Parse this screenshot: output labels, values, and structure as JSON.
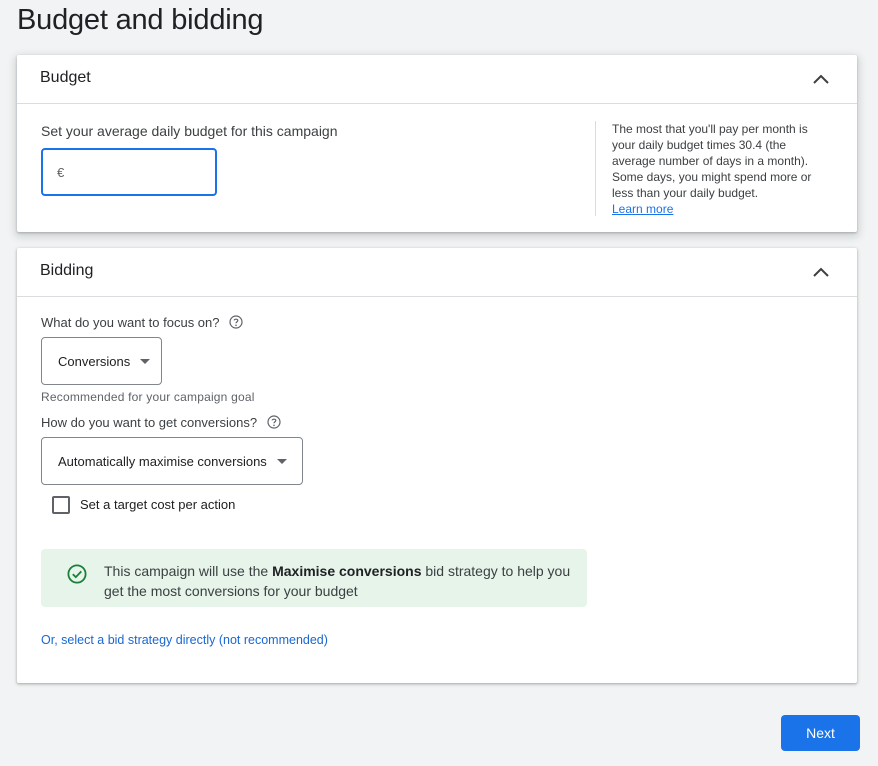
{
  "page": {
    "title": "Budget and bidding"
  },
  "budget": {
    "title": "Budget",
    "prompt": "Set your average daily budget for this campaign",
    "currency_symbol": "€",
    "value": "",
    "side_note": "The most that you'll pay per month is your daily budget times 30.4 (the average number of days in a month). Some days, you might spend more or less than your daily budget.",
    "learn_more": "Learn more"
  },
  "bidding": {
    "title": "Bidding",
    "focus_question": "What do you want to focus on?",
    "focus_value": "Conversions",
    "focus_hint": "Recommended for your campaign goal",
    "method_question": "How do you want to get conversions?",
    "method_value": "Automatically maximise conversions",
    "target_checkbox_label": "Set a target cost per action",
    "notice": {
      "prefix": "This campaign will use the ",
      "strategy": "Maximise conversions",
      "suffix": " bid strategy to help you get the most conversions for your budget"
    },
    "direct_link": "Or, select a bid strategy directly (not recommended)"
  },
  "footer": {
    "next_label": "Next"
  },
  "colors": {
    "accent": "#1a73e8",
    "success_bg": "#e6f4ea",
    "success_icon": "#188038"
  }
}
